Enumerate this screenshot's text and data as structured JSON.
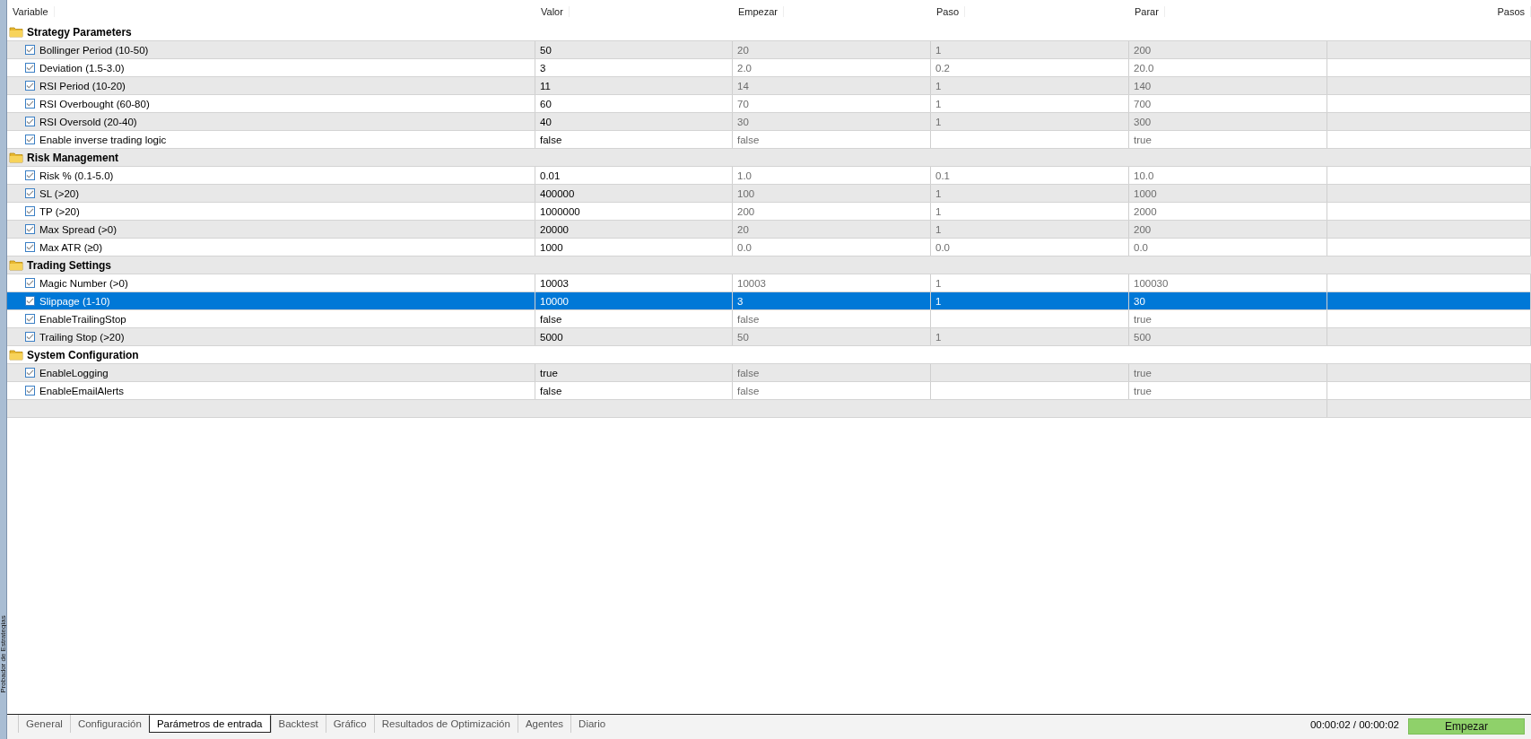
{
  "side_panel": {
    "title": "Probador de Estrategias"
  },
  "table": {
    "columns": [
      "Variable",
      "Valor",
      "Empezar",
      "Paso",
      "Parar",
      "Pasos"
    ],
    "groups": [
      {
        "name": "Strategy Parameters",
        "params": [
          {
            "name": "Bollinger Period (10-50)",
            "checked": true,
            "selected": false,
            "value": "50",
            "start": "20",
            "step": "1",
            "stop": "200"
          },
          {
            "name": "Deviation (1.5-3.0)",
            "checked": true,
            "selected": false,
            "value": "3",
            "start": "2.0",
            "step": "0.2",
            "stop": "20.0"
          },
          {
            "name": "RSI Period (10-20)",
            "checked": true,
            "selected": false,
            "value": "11",
            "start": "14",
            "step": "1",
            "stop": "140"
          },
          {
            "name": "RSI Overbought (60-80)",
            "checked": true,
            "selected": false,
            "value": "60",
            "start": "70",
            "step": "1",
            "stop": "700"
          },
          {
            "name": "RSI Oversold (20-40)",
            "checked": true,
            "selected": false,
            "value": "40",
            "start": "30",
            "step": "1",
            "stop": "300"
          },
          {
            "name": "Enable inverse trading logic",
            "checked": true,
            "selected": false,
            "value": "false",
            "start": "false",
            "stop": "true"
          }
        ]
      },
      {
        "name": "Risk Management",
        "params": [
          {
            "name": "Risk % (0.1-5.0)",
            "checked": true,
            "selected": false,
            "value": "0.01",
            "start": "1.0",
            "step": "0.1",
            "stop": "10.0"
          },
          {
            "name": "SL (>20)",
            "checked": true,
            "selected": false,
            "value": "400000",
            "start": "100",
            "step": "1",
            "stop": "1000"
          },
          {
            "name": "TP (>20)",
            "checked": true,
            "selected": false,
            "value": "1000000",
            "start": "200",
            "step": "1",
            "stop": "2000"
          },
          {
            "name": "Max Spread (>0)",
            "checked": true,
            "selected": false,
            "value": "20000",
            "start": "20",
            "step": "1",
            "stop": "200"
          },
          {
            "name": "Max ATR (≥0)",
            "checked": true,
            "selected": false,
            "value": "1000",
            "start": "0.0",
            "step": "0.0",
            "stop": "0.0"
          }
        ]
      },
      {
        "name": "Trading Settings",
        "params": [
          {
            "name": "Magic Number (>0)",
            "checked": true,
            "selected": false,
            "value": "10003",
            "start": "10003",
            "step": "1",
            "stop": "100030"
          },
          {
            "name": "Slippage (1-10)",
            "checked": true,
            "selected": true,
            "value": "10000",
            "start": "3",
            "step": "1",
            "stop": "30"
          },
          {
            "name": "EnableTrailingStop",
            "checked": true,
            "selected": false,
            "value": "false",
            "start": "false",
            "stop": "true"
          },
          {
            "name": "Trailing Stop (>20)",
            "checked": true,
            "selected": false,
            "value": "5000",
            "start": "50",
            "step": "1",
            "stop": "500"
          }
        ]
      },
      {
        "name": "System Configuration",
        "params": [
          {
            "name": "EnableLogging",
            "checked": true,
            "selected": false,
            "value": "true",
            "start": "false",
            "stop": "true"
          },
          {
            "name": "EnableEmailAlerts",
            "checked": true,
            "selected": false,
            "value": "false",
            "start": "false",
            "stop": "true"
          }
        ]
      }
    ]
  },
  "tabs": [
    {
      "label": "General",
      "selected": false
    },
    {
      "label": "Configuración",
      "selected": false
    },
    {
      "label": "Parámetros de entrada",
      "selected": true
    },
    {
      "label": "Backtest",
      "selected": false
    },
    {
      "label": "Gráfico",
      "selected": false
    },
    {
      "label": "Resultados de Optimización",
      "selected": false
    },
    {
      "label": "Agentes",
      "selected": false
    },
    {
      "label": "Diario",
      "selected": false
    }
  ],
  "status": {
    "elapsed": "00:00:02 / 00:00:02",
    "start_button": "Empezar"
  }
}
